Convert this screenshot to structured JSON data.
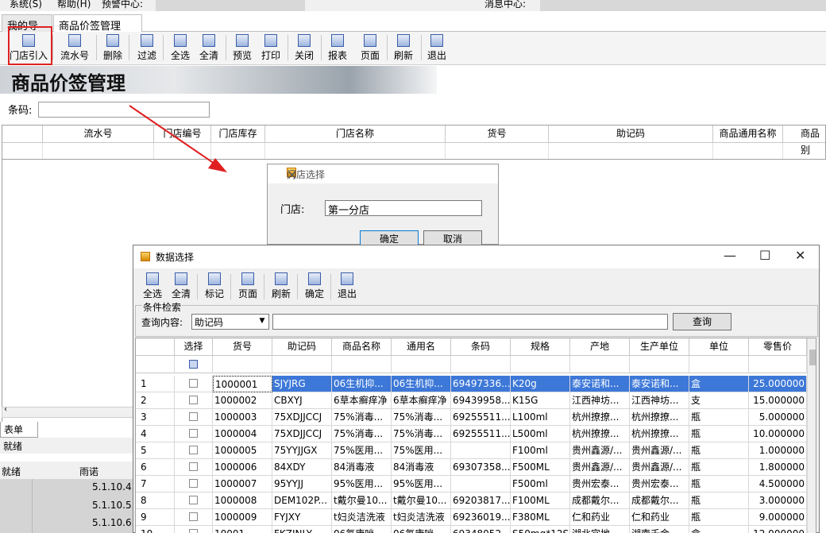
{
  "menu": {
    "items": [
      "系统(S)",
      "帮助(H)",
      "预警中心:",
      "消息中心:"
    ]
  },
  "doc_tabs": [
    {
      "label": "我的导航"
    },
    {
      "label": "商品价签管理",
      "close": "×"
    }
  ],
  "toolbar": {
    "items": [
      "门店引入",
      "流水号",
      "删除",
      "过滤",
      "全选",
      "全清",
      "预览",
      "打印",
      "关闭",
      "报表",
      "页面",
      "刷新",
      "退出"
    ]
  },
  "banner": {
    "title": "商品价签管理"
  },
  "barcode": {
    "label": "条码:",
    "value": ""
  },
  "main_grid": {
    "headers": [
      "",
      "流水号",
      "门店编号",
      "门店库存",
      "门店名称",
      "货号",
      "助记码",
      "商品通用名称",
      "商品别"
    ]
  },
  "bottom": {
    "tab": "表单",
    "status1": "就绪",
    "status2_left": "就绪",
    "status2_right": "雨诺202008",
    "tree": [
      "5.1.10.4.",
      "5.1.10.5.",
      "5.1.10.6."
    ]
  },
  "store_dialog": {
    "title": "门店选择",
    "close": "✕",
    "label": "门店:",
    "value": "第一分店",
    "ok": "确定",
    "cancel": "取消"
  },
  "data_dialog": {
    "title": "数据选择",
    "window_controls": [
      "—",
      "☐",
      "✕"
    ],
    "toolbar": [
      "全选",
      "全清",
      "标记",
      "页面",
      "刷新",
      "确定",
      "退出"
    ],
    "condition": {
      "legend": "条件检索",
      "label": "查询内容:",
      "field": "助记码",
      "query": "",
      "button": "查询"
    },
    "columns": [
      "",
      "选择",
      "货号",
      "助记码",
      "商品名称",
      "通用名",
      "条码",
      "规格",
      "产地",
      "生产单位",
      "单位",
      "零售价"
    ],
    "rows": [
      [
        "1",
        "1000001",
        "SJYJRG",
        "06生机抑...",
        "06生机抑...",
        "69497336...",
        "K20g",
        "泰安诺和...",
        "泰安诺和...",
        "盒",
        "25.000000"
      ],
      [
        "2",
        "1000002",
        "CBXYJ",
        "6草本癣痒净",
        "6草本癣痒净",
        "69439958...",
        "K15G",
        "江西神坊...",
        "江西神坊...",
        "支",
        "15.000000"
      ],
      [
        "3",
        "1000003",
        "75XDJJCCJ",
        "75%消毒...",
        "75%消毒...",
        "69255511...",
        "L100ml",
        "杭州撩撩...",
        "杭州撩撩...",
        "瓶",
        "5.000000"
      ],
      [
        "4",
        "1000004",
        "75XDJJCCJ",
        "75%消毒...",
        "75%消毒...",
        "69255511...",
        "L500ml",
        "杭州撩撩...",
        "杭州撩撩...",
        "瓶",
        "10.000000"
      ],
      [
        "5",
        "1000005",
        "75YYJJGX",
        "75%医用...",
        "75%医用...",
        "",
        "F100ml",
        "贵州鑫源/...",
        "贵州鑫源/...",
        "瓶",
        "1.000000"
      ],
      [
        "6",
        "1000006",
        "84XDY",
        "84消毒液",
        "84消毒液",
        "69307358...",
        "F500ML",
        "贵州鑫源/...",
        "贵州鑫源/...",
        "瓶",
        "1.800000"
      ],
      [
        "7",
        "1000007",
        "95YYJJ",
        "95%医用...",
        "95%医用...",
        "",
        "F500ml",
        "贵州宏泰...",
        "贵州宏泰...",
        "瓶",
        "4.500000"
      ],
      [
        "8",
        "1000008",
        "DEM102P...",
        "t戴尔曼10...",
        "t戴尔曼10...",
        "69203817...",
        "F100ML",
        "成都戴尔...",
        "成都戴尔...",
        "瓶",
        "3.000000"
      ],
      [
        "9",
        "1000009",
        "FYJXY",
        "t妇炎洁洗液",
        "t妇炎洁洗液",
        "69236019...",
        "F380ML",
        "仁和药业",
        "仁和药业",
        "瓶",
        "9.000000"
      ],
      [
        "10",
        "10001",
        "FKZJNLY",
        "06氟康唑...",
        "06氟康唑...",
        "69348052...",
        "S50mg*12S",
        "湖北宜地...",
        "湖南千金...",
        "盒",
        "12.000000"
      ]
    ]
  },
  "colors": {
    "highlight": "#e02020",
    "arrow": "#e02020",
    "selected_row": "#3d78d8"
  }
}
